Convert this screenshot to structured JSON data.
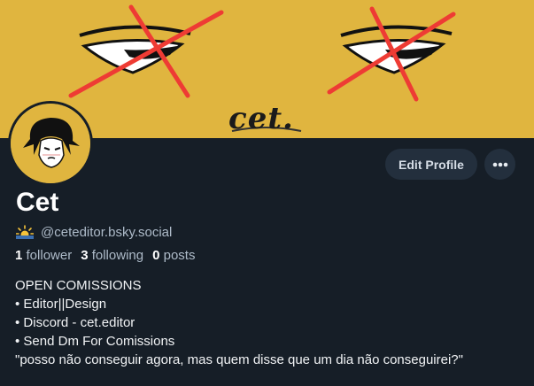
{
  "banner": {
    "text": "cet.",
    "colors": {
      "background": "#e0b53f",
      "cross": "#ee3b34"
    }
  },
  "avatar": {
    "icon": "cartoon-face-avatar"
  },
  "actions": {
    "edit_label": "Edit Profile",
    "more_icon": "ellipsis-icon"
  },
  "profile": {
    "display_name": "Cet",
    "handle_icon": "sun-horizon-emoji",
    "handle": "@ceteditor.bsky.social"
  },
  "stats": {
    "followers_count": "1",
    "followers_label": "follower",
    "following_count": "3",
    "following_label": "following",
    "posts_count": "0",
    "posts_label": "posts"
  },
  "bio": {
    "lines": [
      "OPEN COMISSIONS",
      "• Editor||Design",
      "• Discord - cet.editor",
      "• Send Dm For Comissions",
      "\"posso não conseguir agora, mas quem disse que um dia não conseguirei?\""
    ]
  },
  "colors": {
    "page_background": "#161e27",
    "button_background": "#232f3d",
    "muted_text": "#aebbc9"
  }
}
